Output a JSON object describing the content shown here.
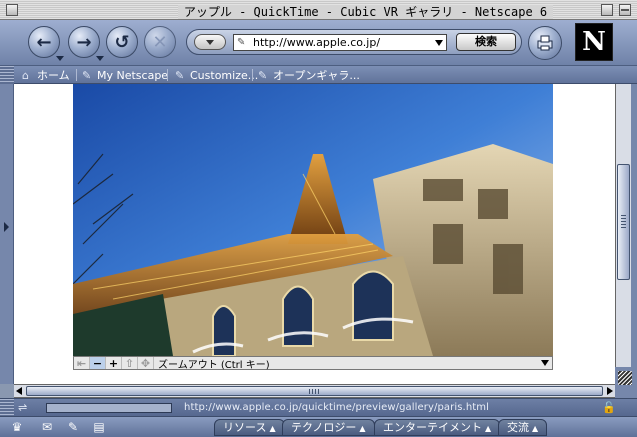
{
  "window": {
    "title": "アップル - QuickTime - Cubic VR ギャラリ - Netscape 6"
  },
  "navbar": {
    "back_icon": "back-arrow-icon",
    "forward_icon": "forward-arrow-icon",
    "reload_icon": "reload-icon",
    "stop_icon": "stop-icon",
    "url": "http://www.apple.co.jp/",
    "search_label": "検索",
    "print_icon": "print-icon",
    "logo_letter": "N"
  },
  "personal_toolbar": {
    "items": [
      {
        "label": "ホーム",
        "icon": "home-icon"
      },
      {
        "label": "My Netscape",
        "icon": "bookmark-icon"
      },
      {
        "label": "Customize...",
        "icon": "bookmark-icon"
      },
      {
        "label": "オープンギャラ...",
        "icon": "bookmark-icon"
      }
    ]
  },
  "quicktime": {
    "status_text": "ズームアウト (Ctrl キー)",
    "buttons": [
      "back",
      "zoom-out",
      "zoom-in",
      "hotspot",
      "move"
    ]
  },
  "statusbar": {
    "url": "http://www.apple.co.jp/quicktime/preview/gallery/paris.html"
  },
  "taskbar": {
    "tabs": [
      {
        "label": "リソース"
      },
      {
        "label": "テクノロジー"
      },
      {
        "label": "エンターテイメント"
      },
      {
        "label": "交流"
      }
    ]
  },
  "colors": {
    "chrome": "#7687ab",
    "content_bg": "#ffffff",
    "sky": "#3a78d0"
  }
}
